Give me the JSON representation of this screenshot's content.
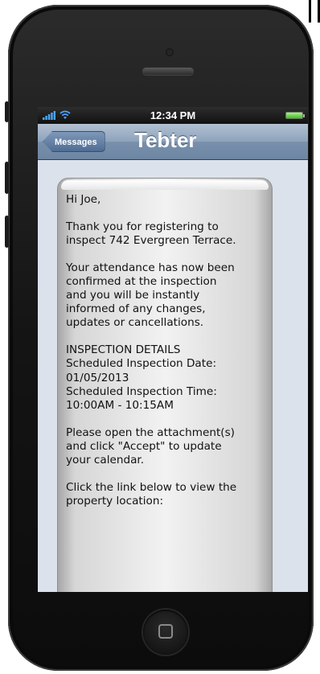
{
  "status_bar": {
    "time": "12:34 PM"
  },
  "nav_bar": {
    "back_label": "Messages",
    "title": "Tebter"
  },
  "message": {
    "greeting": "Hi Joe,",
    "paragraph_1": "Thank you for registering to\ninspect 742 Evergreen Terrace.",
    "paragraph_2": "Your attendance has now been\nconfirmed at the inspection\nand you will be instantly\ninformed of any changes,\nupdates or cancellations.",
    "details_heading": "INSPECTION DETAILS",
    "date_label": "Scheduled Inspection Date:",
    "date_value": "01/05/2013",
    "time_label": "Scheduled Inspection Time:",
    "time_value": "10:00AM - 10:15AM",
    "paragraph_3": "Please open the attachment(s)\nand click \"Accept\" to update\nyour calendar.",
    "paragraph_4": "Click the link below to view the\nproperty location:"
  },
  "colors": {
    "nav_bar": "#7f97b3",
    "content_bg": "#dbe2ec",
    "battery": "#4cc928"
  }
}
